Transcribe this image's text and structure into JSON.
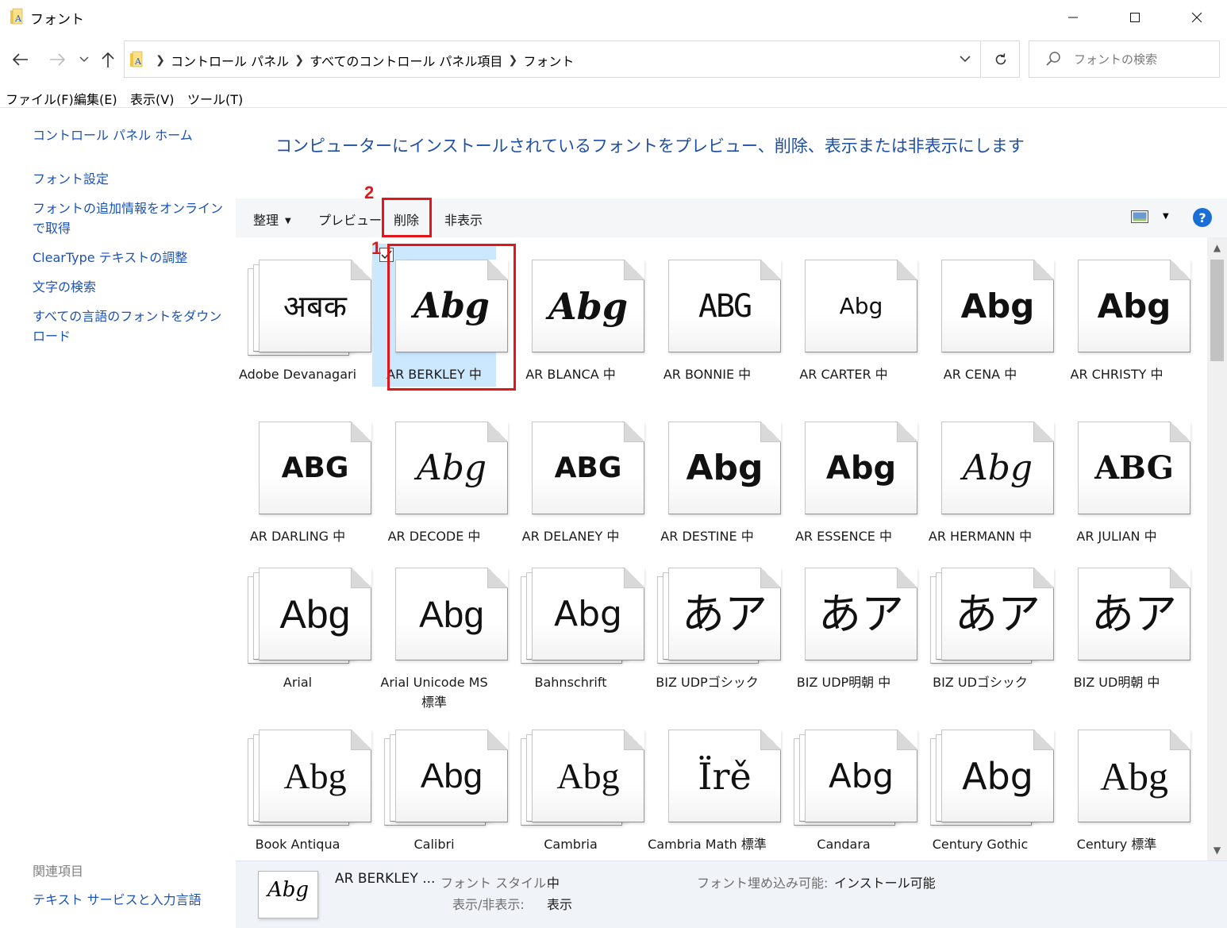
{
  "window": {
    "title": "フォント",
    "minimize_icon": "minimize-icon",
    "maximize_icon": "maximize-icon",
    "close_icon": "close-icon"
  },
  "address": {
    "crumbs": [
      "コントロール パネル",
      "すべてのコントロール パネル項目",
      "フォント"
    ],
    "search_placeholder": "フォントの検索"
  },
  "menubar": {
    "file": "ファイル(F)",
    "edit": "編集(E)",
    "view": "表示(V)",
    "tools": "ツール(T)"
  },
  "leftnav": {
    "items": [
      "コントロール パネル ホーム",
      "フォント設定",
      "フォントの追加情報をオンラインで取得",
      "ClearType テキストの調整",
      "文字の検索",
      "すべての言語のフォントをダウンロード"
    ],
    "related_heading": "関連項目",
    "related_link": "テキスト サービスと入力言語"
  },
  "heading": "コンピューターにインストールされているフォントをプレビュー、削除、表示または非表示にします",
  "toolbar": {
    "organize": "整理",
    "preview": "プレビュー",
    "delete": "削除",
    "hide": "非表示",
    "help": "?"
  },
  "annotations": {
    "one": "1",
    "two": "2"
  },
  "fonts": [
    {
      "name": "Adobe Devanagari",
      "sample": "अबक",
      "stack": 1
    },
    {
      "name": "AR BERKLEY 中",
      "sample": "Abg",
      "stack": 0,
      "selected": true
    },
    {
      "name": "AR BLANCA 中",
      "sample": "Abg",
      "stack": 0
    },
    {
      "name": "AR BONNIE 中",
      "sample": "ABG",
      "stack": 0
    },
    {
      "name": "AR CARTER 中",
      "sample": "Abg",
      "stack": 0
    },
    {
      "name": "AR CENA 中",
      "sample": "Abg",
      "stack": 0
    },
    {
      "name": "AR CHRISTY 中",
      "sample": "Abg",
      "stack": 0
    },
    {
      "name": "AR DARLING 中",
      "sample": "ABG",
      "stack": 0
    },
    {
      "name": "AR DECODE 中",
      "sample": "Abg",
      "stack": 0
    },
    {
      "name": "AR DELANEY 中",
      "sample": "ABG",
      "stack": 0
    },
    {
      "name": "AR DESTINE 中",
      "sample": "Abg",
      "stack": 0
    },
    {
      "name": "AR ESSENCE 中",
      "sample": "Abg",
      "stack": 0
    },
    {
      "name": "AR HERMANN 中",
      "sample": "Abg",
      "stack": 0
    },
    {
      "name": "AR JULIAN 中",
      "sample": "ABG",
      "stack": 0
    },
    {
      "name": "Arial",
      "sample": "Abg",
      "stack": 1
    },
    {
      "name": "Arial Unicode MS 標準",
      "sample": "Abg",
      "stack": 0
    },
    {
      "name": "Bahnschrift",
      "sample": "Abg",
      "stack": 1
    },
    {
      "name": "BIZ UDPゴシック",
      "sample": "あア",
      "stack": 1
    },
    {
      "name": "BIZ UDP明朝 中",
      "sample": "あア",
      "stack": 0
    },
    {
      "name": "BIZ UDゴシック",
      "sample": "あア",
      "stack": 1
    },
    {
      "name": "BIZ UD明朝 中",
      "sample": "あア",
      "stack": 0
    },
    {
      "name": "Book Antiqua",
      "sample": "Abg",
      "stack": 1
    },
    {
      "name": "Calibri",
      "sample": "Abg",
      "stack": 1
    },
    {
      "name": "Cambria",
      "sample": "Abg",
      "stack": 1
    },
    {
      "name": "Cambria Math 標準",
      "sample": "Ïrě",
      "stack": 0
    },
    {
      "name": "Candara",
      "sample": "Abg",
      "stack": 1
    },
    {
      "name": "Century Gothic",
      "sample": "Abg",
      "stack": 1
    },
    {
      "name": "Century 標準",
      "sample": "Abg",
      "stack": 0
    }
  ],
  "details": {
    "name": "AR BERKLEY ...",
    "sample": "Abg",
    "style_label": "フォント スタイル:",
    "style_value": "中",
    "visibility_label": "表示/非表示:",
    "visibility_value": "表示",
    "embed_label": "フォント埋め込み可能:",
    "embed_value": "インストール可能"
  },
  "colors": {
    "accent": "#1a52b8",
    "selection": "#cce8ff",
    "annotation": "#e0161b"
  }
}
